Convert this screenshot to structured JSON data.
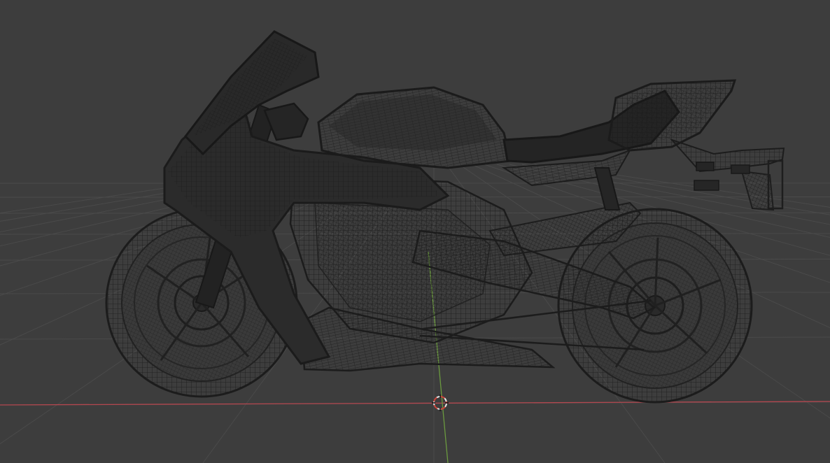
{
  "viewport": {
    "background_color": "#3d3d3d",
    "grid_color": "#4d4d4d",
    "x_axis_color": "#b3474f",
    "y_axis_color": "#6b9a3f",
    "cursor_outer_color": "#e8e8e8",
    "cursor_inner_color": "#d0443a"
  },
  "model": {
    "wire_color": "#1e1e1e",
    "shade_color": "#262626",
    "parts": [
      "windscreen",
      "front-fairing",
      "fuel-tank",
      "seat",
      "tail-section",
      "license-plate-bracket",
      "front-wheel",
      "rear-wheel",
      "front-fork",
      "swingarm",
      "exhaust",
      "engine",
      "belly-pan",
      "drive-chain"
    ]
  },
  "icons": {
    "cursor": "3d-cursor-icon"
  }
}
